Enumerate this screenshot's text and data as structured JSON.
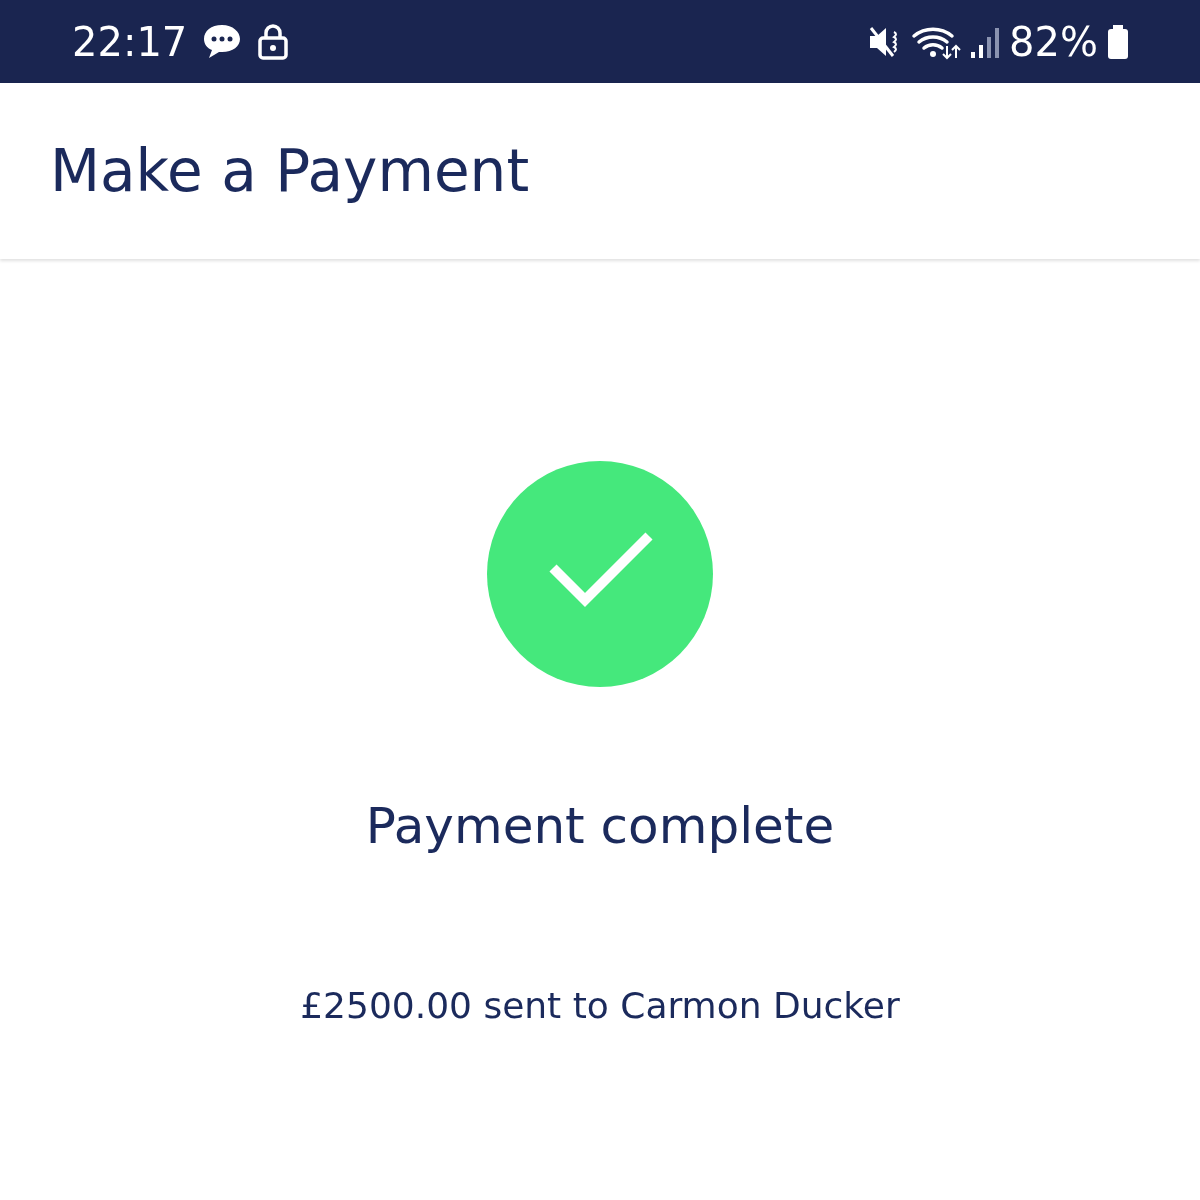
{
  "status_bar": {
    "time": "22:17",
    "battery": "82%"
  },
  "app_bar": {
    "title": "Make a Payment"
  },
  "result": {
    "succeeded": true,
    "title": "Payment complete",
    "message": "£2500.00 sent to Carmon Ducker"
  }
}
